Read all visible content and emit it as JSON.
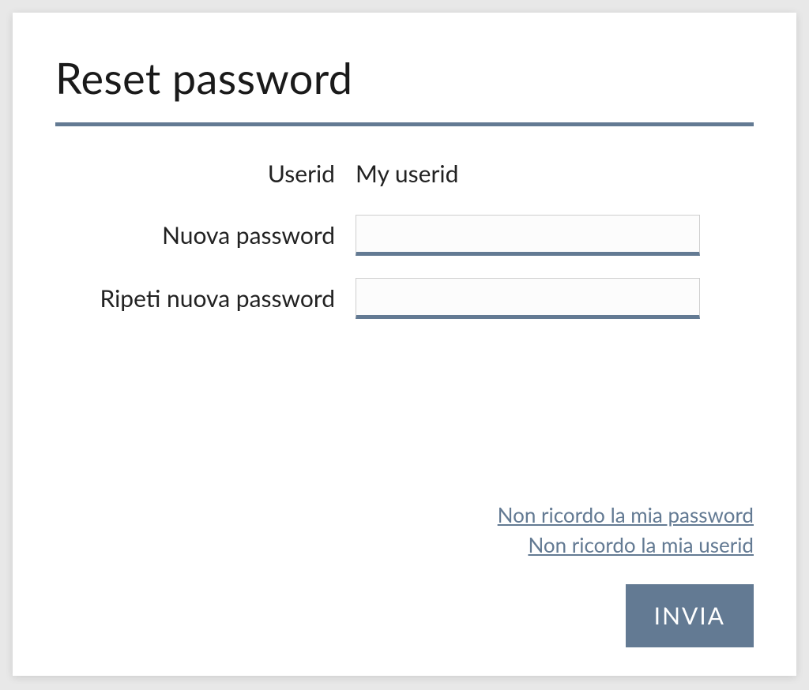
{
  "title": "Reset password",
  "form": {
    "userid_label": "Userid",
    "userid_value": "My userid",
    "new_password_label": "Nuova password",
    "new_password_value": "",
    "repeat_password_label": "Ripeti nuova password",
    "repeat_password_value": ""
  },
  "links": {
    "forgot_password": "Non ricordo la mia password",
    "forgot_userid": "Non ricordo la mia userid"
  },
  "buttons": {
    "submit": "INVIA"
  },
  "colors": {
    "accent": "#637a93"
  }
}
